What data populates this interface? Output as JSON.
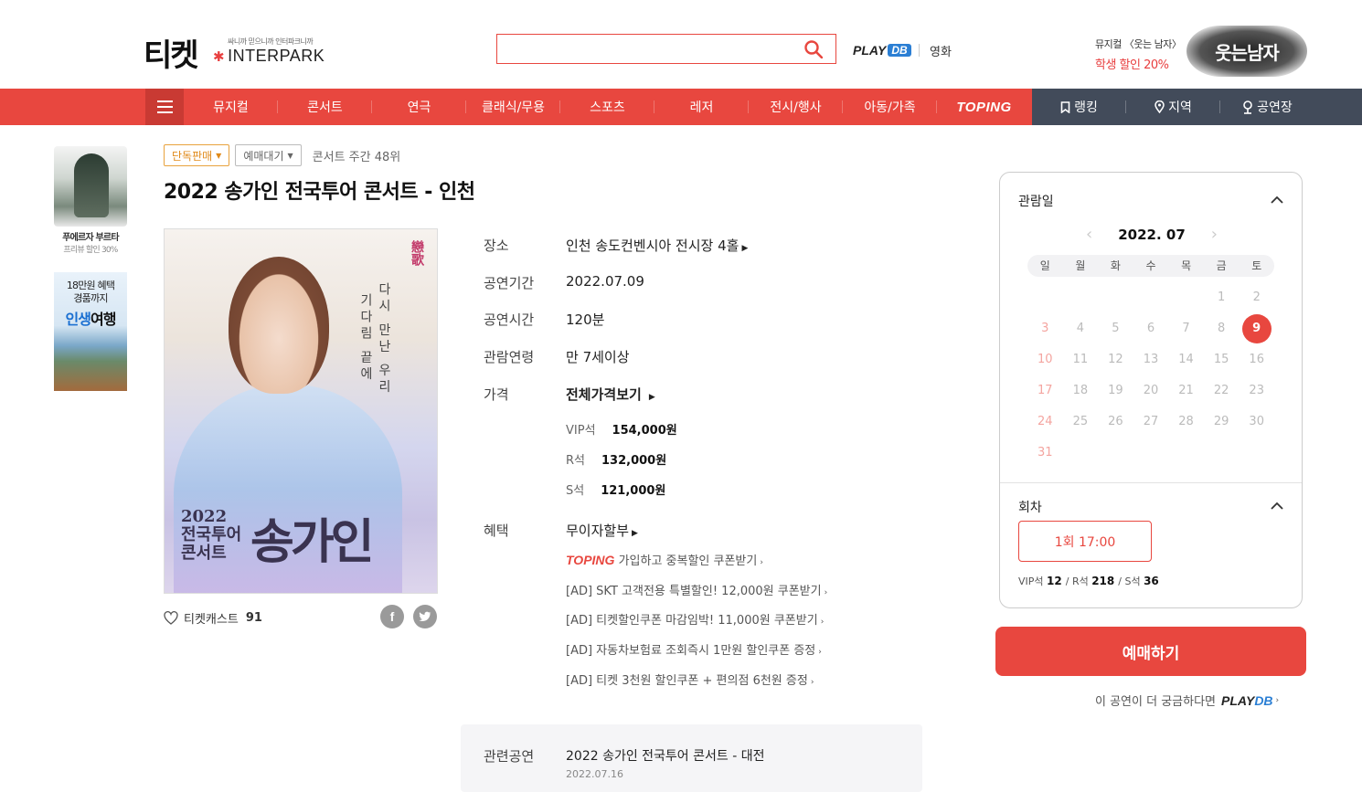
{
  "header": {
    "logo": "티켓",
    "logo_tagline": "싸니까 믿으니까 인터파크니까",
    "logo_brand": "INTERPARK",
    "search_placeholder": "",
    "playdb_play": "PLAY",
    "playdb_db": "DB",
    "movie_link": "영화",
    "promo_line1": "뮤지컬 〈웃는 남자〉",
    "promo_line2": "학생 할인 20%",
    "promo_image_text": "웃는남자"
  },
  "nav": {
    "items": [
      "뮤지컬",
      "콘서트",
      "연극",
      "클래식/무용",
      "스포츠",
      "레저",
      "전시/행사",
      "아동/가족",
      "TOPING"
    ],
    "right_items": [
      "랭킹",
      "지역",
      "공연장"
    ]
  },
  "side_ads": {
    "ad1_title": "푸에르자 부르타",
    "ad1_sub": "프리뷰 할인 30%",
    "ad2_line1": "18만원 혜택",
    "ad2_line2": "경품까지",
    "ad2_big_a": "인생",
    "ad2_big_b": "여행"
  },
  "product": {
    "badge_exclusive": "단독판매",
    "badge_waiting": "예매대기",
    "rank": "콘서트 주간 48위",
    "title": "2022 송가인 전국투어 콘서트 - 인천",
    "poster": {
      "vtext1": "다시 만난 우리",
      "vtext2": "기다림 끝에",
      "red_mark": "戀歌",
      "year": "2022",
      "tour_line1": "전국투어",
      "tour_line2": "콘서트",
      "name": "송가인"
    },
    "ticketcast_label": "티켓캐스트",
    "ticketcast_count": "91",
    "share_facebook": "f",
    "share_twitter": "t"
  },
  "info": {
    "venue_label": "장소",
    "venue": "인천 송도컨벤시아 전시장 4홀",
    "period_label": "공연기간",
    "period": "2022.07.09",
    "duration_label": "공연시간",
    "duration": "120분",
    "age_label": "관람연령",
    "age": "만 7세이상",
    "price_label": "가격",
    "price_all": "전체가격보기",
    "prices": [
      {
        "seat": "VIP석",
        "price": "154,000원"
      },
      {
        "seat": "R석",
        "price": "132,000원"
      },
      {
        "seat": "S석",
        "price": "121,000원"
      }
    ],
    "benefit_label": "혜택",
    "benefit_installment": "무이자할부",
    "toping_brand": "TOPING",
    "toping_text": "가입하고 중복할인 쿠폰받기",
    "ads": [
      "[AD] SKT 고객전용 특별할인! 12,000원 쿠폰받기",
      "[AD] 티켓할인쿠폰 마감임박! 11,000원 쿠폰받기",
      "[AD] 자동차보험료 조회즉시 1만원 할인쿠폰 증정",
      "[AD] 티켓 3천원 할인쿠폰 + 편의점 6천원 증정"
    ]
  },
  "related": {
    "label": "관련공연",
    "title": "2022 송가인 전국투어 콘서트 - 대전",
    "date": "2022.07.16"
  },
  "calendar": {
    "section_title": "관람일",
    "month": "2022. 07",
    "weekdays": [
      "일",
      "월",
      "화",
      "수",
      "목",
      "금",
      "토"
    ],
    "first_weekday": 5,
    "days_in_month": 31,
    "selected_day": 9
  },
  "session": {
    "section_title": "회차",
    "button": "1회 17:00",
    "seats": [
      {
        "grade": "VIP석",
        "count": "12"
      },
      {
        "grade": "R석",
        "count": "218"
      },
      {
        "grade": "S석",
        "count": "36"
      }
    ]
  },
  "booking": {
    "button": "예매하기",
    "more_text": "이 공연이 더 궁금하다면",
    "more_brand_play": "PLAY",
    "more_brand_db": "DB"
  },
  "colors": {
    "brand_red": "#e8473f",
    "nav_dark": "#424b5a",
    "badge_orange": "#e08a1a",
    "playdb_blue": "#2b7fd4"
  }
}
